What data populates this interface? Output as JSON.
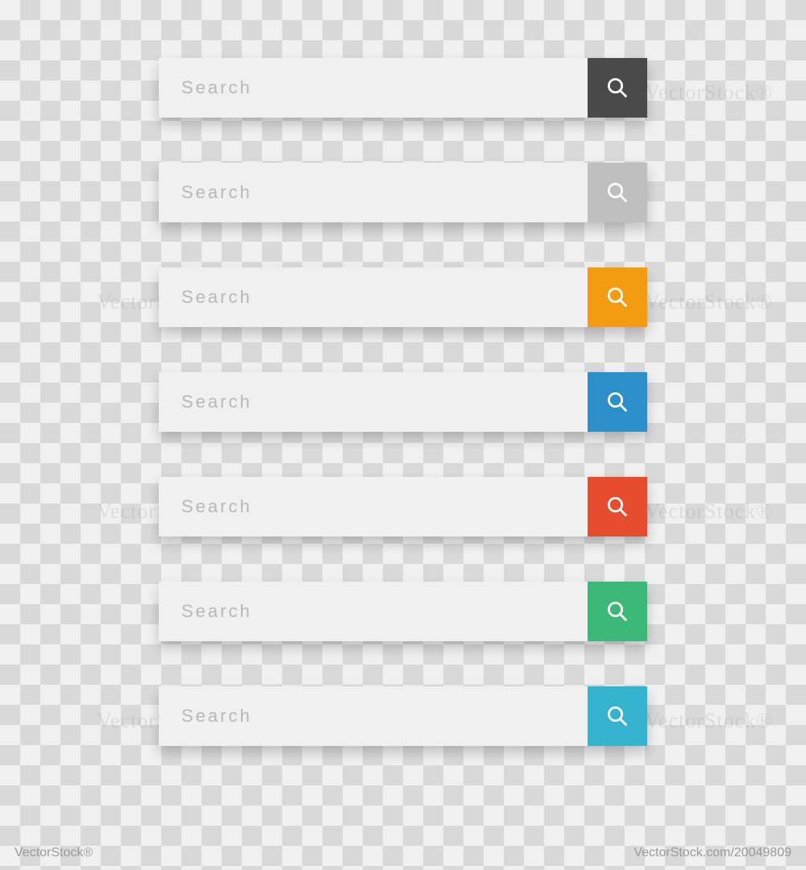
{
  "search_bars": [
    {
      "placeholder": "Search",
      "button_color": "#4a4a4a"
    },
    {
      "placeholder": "Search",
      "button_color": "#bfbfbf"
    },
    {
      "placeholder": "Search",
      "button_color": "#f39c12"
    },
    {
      "placeholder": "Search",
      "button_color": "#2c8fc9"
    },
    {
      "placeholder": "Search",
      "button_color": "#e64c2e"
    },
    {
      "placeholder": "Search",
      "button_color": "#3cb878"
    },
    {
      "placeholder": "Search",
      "button_color": "#35b3cf"
    }
  ],
  "watermark": "VectorStock®",
  "footer": {
    "brand": "VectorStock®",
    "id": "VectorStock.com/20049809"
  }
}
